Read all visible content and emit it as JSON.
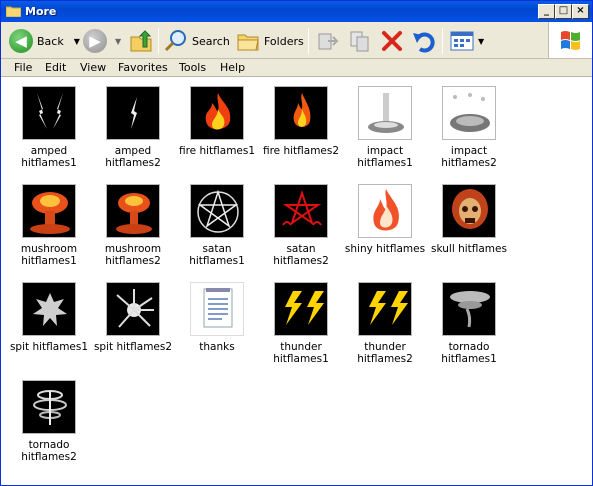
{
  "window": {
    "title": "More"
  },
  "toolbar": {
    "back": "Back",
    "search": "Search",
    "folders": "Folders"
  },
  "menu": [
    "File",
    "Edit",
    "View",
    "Favorites",
    "Tools",
    "Help"
  ],
  "items": [
    {
      "label": "amped hitflames1",
      "icon": "amped-flames"
    },
    {
      "label": "amped hitflames2",
      "icon": "amped-flames"
    },
    {
      "label": "fire hitflames1",
      "icon": "fire"
    },
    {
      "label": "fire hitflames2",
      "icon": "fire"
    },
    {
      "label": "impact hitflames1",
      "icon": "impact"
    },
    {
      "label": "impact hitflames2",
      "icon": "impact"
    },
    {
      "label": "mushroom hitflames1",
      "icon": "mushroom-cloud"
    },
    {
      "label": "mushroom hitflames2",
      "icon": "mushroom-cloud"
    },
    {
      "label": "satan hitflames1",
      "icon": "pentagram"
    },
    {
      "label": "satan hitflames2",
      "icon": "pentagram"
    },
    {
      "label": "shiny hitflames",
      "icon": "shiny-flame"
    },
    {
      "label": "skull hitflames",
      "icon": "skull"
    },
    {
      "label": "spit hitflames1",
      "icon": "splat"
    },
    {
      "label": "spit hitflames2",
      "icon": "splat"
    },
    {
      "label": "thanks",
      "icon": "text-document"
    },
    {
      "label": "thunder hitflames1",
      "icon": "lightning"
    },
    {
      "label": "thunder hitflames2",
      "icon": "lightning"
    },
    {
      "label": "tornado hitflames1",
      "icon": "tornado"
    },
    {
      "label": "tornado hitflames2",
      "icon": "tornado"
    }
  ]
}
